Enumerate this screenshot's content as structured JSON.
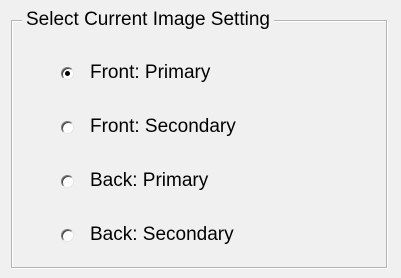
{
  "group": {
    "title": "Select Current Image Setting"
  },
  "options": [
    {
      "label": "Front: Primary",
      "checked": true
    },
    {
      "label": "Front: Secondary",
      "checked": false
    },
    {
      "label": "Back: Primary",
      "checked": false
    },
    {
      "label": "Back: Secondary",
      "checked": false
    }
  ]
}
